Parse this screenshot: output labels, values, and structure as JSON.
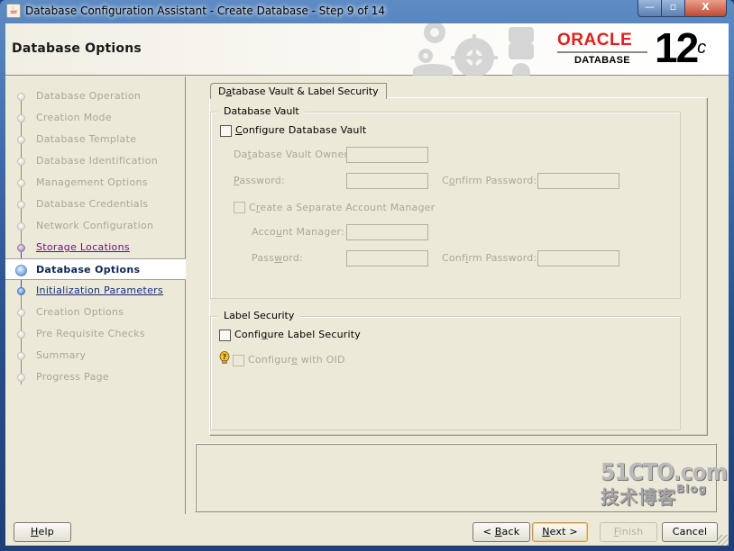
{
  "window": {
    "title": "Database Configuration Assistant - Create Database - Step 9 of 14",
    "controls": {
      "minimize": "—",
      "maximize": "▫",
      "close": "X"
    }
  },
  "header": {
    "page_title": "Database Options",
    "logo": {
      "brand": "ORACLE",
      "product": "DATABASE",
      "version": "12",
      "version_suffix": "c",
      "brand_color": "#e0201b"
    }
  },
  "sidebar": {
    "steps": [
      {
        "label": "Database Operation",
        "state": "done"
      },
      {
        "label": "Creation Mode",
        "state": "done"
      },
      {
        "label": "Database Template",
        "state": "done"
      },
      {
        "label": "Database Identification",
        "state": "done"
      },
      {
        "label": "Management Options",
        "state": "done"
      },
      {
        "label": "Database Credentials",
        "state": "done"
      },
      {
        "label": "Network Configuration",
        "state": "done"
      },
      {
        "label": "Storage Locations",
        "state": "visited"
      },
      {
        "label": "Database Options",
        "state": "current"
      },
      {
        "label": "Initialization Parameters",
        "state": "next"
      },
      {
        "label": "Creation Options",
        "state": "pending"
      },
      {
        "label": "Pre Requisite Checks",
        "state": "pending"
      },
      {
        "label": "Summary",
        "state": "pending"
      },
      {
        "label": "Progress Page",
        "state": "pending"
      }
    ]
  },
  "main": {
    "tab": {
      "pre": "D",
      "mnemonic": "a",
      "post": "tabase Vault & Label Security"
    },
    "vault": {
      "group_title": "Database Vault",
      "configure": {
        "mnemonic": "C",
        "post": "onfigure Database Vault",
        "checked": false
      },
      "owner": {
        "pre": "Da",
        "mnemonic": "t",
        "post": "abase Vault Owner:",
        "value": ""
      },
      "password": {
        "mnemonic": "P",
        "post": "assword:",
        "value": ""
      },
      "confirm_password": {
        "pre": "C",
        "mnemonic": "o",
        "post": "nfirm Password:",
        "value": ""
      },
      "separate_manager": {
        "pre": "C",
        "mnemonic": "r",
        "post": "eate a Separate Account Manager",
        "checked": false
      },
      "account_manager": {
        "pre": "Acco",
        "mnemonic": "u",
        "post": "nt Manager:",
        "value": ""
      },
      "am_password": {
        "pre": "Pass",
        "mnemonic": "w",
        "post": "ord:",
        "value": ""
      },
      "am_confirm_password": {
        "pre": "Conf",
        "mnemonic": "i",
        "post": "rm Password:",
        "value": ""
      }
    },
    "label_security": {
      "group_title": "Label Security",
      "configure": {
        "pre": "Confi",
        "mnemonic": "g",
        "post": "ure Label Security",
        "checked": false
      },
      "oid": {
        "pre": "Configur",
        "mnemonic": "e",
        "post": " with OID",
        "checked": false
      }
    }
  },
  "footer": {
    "help": {
      "mnemonic": "H",
      "post": "elp"
    },
    "back": {
      "pre": "< ",
      "mnemonic": "B",
      "post": "ack"
    },
    "next": {
      "mnemonic": "N",
      "post": "ext >"
    },
    "finish": {
      "mnemonic": "F",
      "post": "inish"
    },
    "cancel": {
      "label": "Cancel"
    }
  },
  "watermark": {
    "line1": "51CTO.com",
    "line2": "技术博客",
    "blog": "Blog"
  }
}
